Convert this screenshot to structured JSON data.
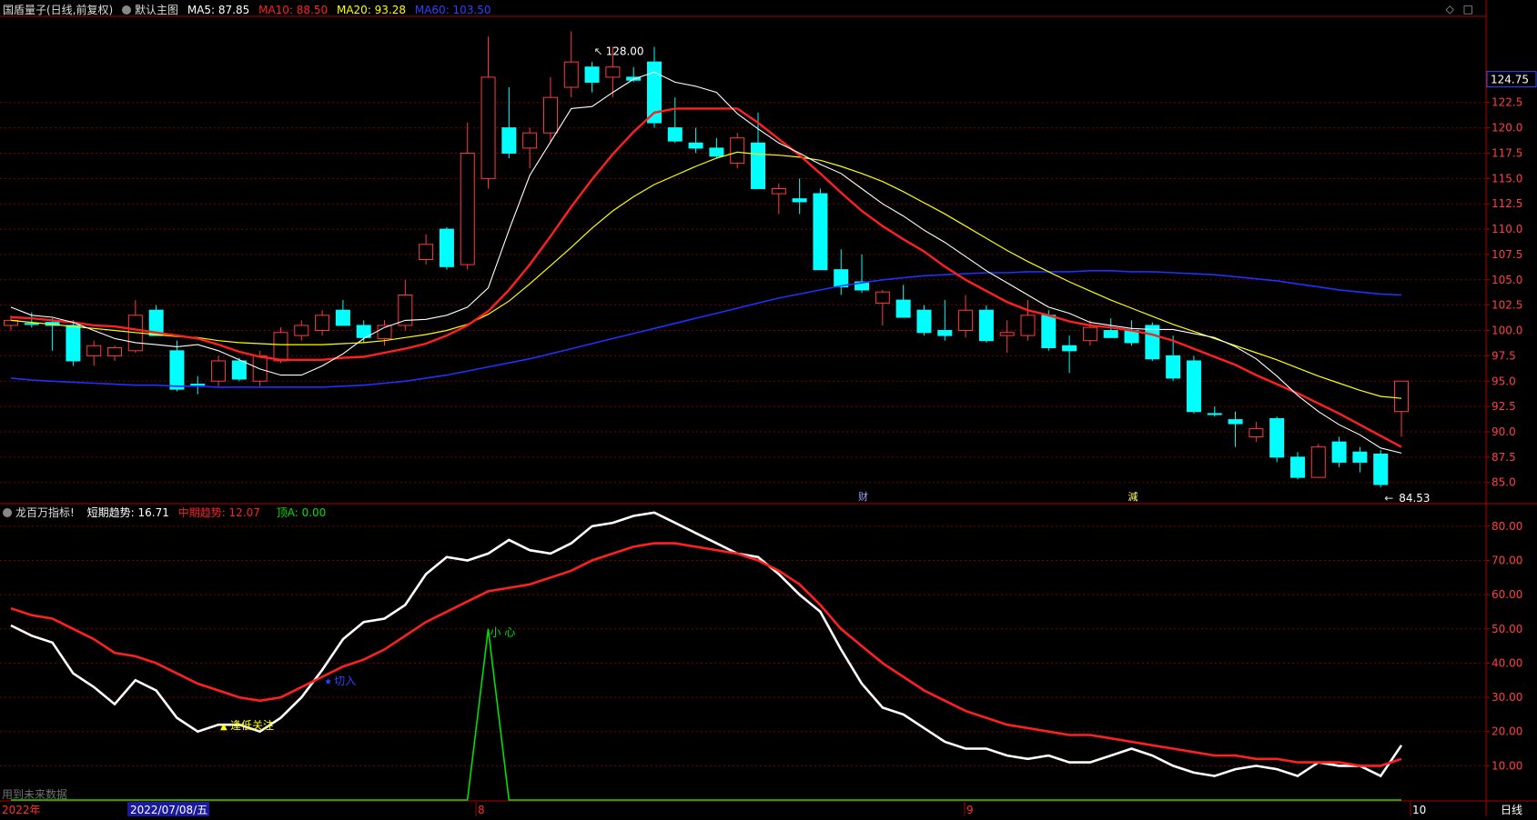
{
  "top_panel": {
    "header": {
      "stock": "国盾量子(日线,前复权)",
      "main_label": "默认主图",
      "ma5": "MA5: 87.85",
      "ma10": "MA10: 88.50",
      "ma20": "MA20: 93.28",
      "ma60": "MA60: 103.50"
    },
    "current_price": "124.75",
    "high_label": "128.00",
    "low_label": "84.53",
    "marker_cai": "财",
    "marker_jian": "減"
  },
  "bottom_panel": {
    "header": {
      "title": "龙百万指标!",
      "short": "短期趋势: 16.71",
      "mid": "中期趋势: 12.07",
      "top": "顶A: 0.00"
    },
    "ann_low": "逢低关注",
    "ann_buy": "切入",
    "ann_careful": "小 心",
    "status_text": "用到未来数据"
  },
  "bottom_axis": {
    "year": "2022年",
    "date": "2022/07/08/五",
    "m8": "8",
    "m9": "9",
    "m10": "10",
    "period": "日线"
  },
  "colors": {
    "up": "#ff3b3b",
    "down": "#00ffff",
    "ma5": "#ffffff",
    "ma10": "#ff2020",
    "ma20": "#ffff00",
    "ma60": "#2030ff",
    "grid": "#7a0000"
  },
  "chart_data": [
    {
      "type": "candlestick",
      "title": "国盾量子(日线,前复权)",
      "ylim": [
        83,
        131
      ],
      "y_ticks": [
        85.0,
        87.5,
        90.0,
        92.5,
        95.0,
        97.5,
        100.0,
        102.5,
        105.0,
        107.5,
        110.0,
        112.5,
        115.0,
        117.5,
        120.0,
        122.5
      ],
      "candles": [
        [
          100.5,
          101.5,
          100.0,
          101.0
        ],
        [
          100.7,
          101.8,
          100.3,
          100.6
        ],
        [
          100.8,
          101.2,
          98.0,
          100.5
        ],
        [
          100.5,
          101.0,
          96.5,
          97.0
        ],
        [
          97.5,
          99.0,
          96.5,
          98.5
        ],
        [
          97.5,
          98.5,
          97.0,
          98.3
        ],
        [
          98.0,
          103.0,
          97.8,
          101.5
        ],
        [
          102.0,
          102.5,
          99.5,
          99.5
        ],
        [
          98.0,
          99.0,
          94.0,
          94.2
        ],
        [
          94.7,
          95.5,
          93.7,
          94.6
        ],
        [
          95.0,
          97.5,
          94.5,
          97.0
        ],
        [
          97.0,
          97.3,
          95.0,
          95.2
        ],
        [
          95.0,
          98.0,
          94.5,
          97.5
        ],
        [
          97.0,
          100.3,
          96.8,
          99.8
        ],
        [
          99.5,
          101.0,
          99.0,
          100.5
        ],
        [
          100.0,
          102.0,
          99.5,
          101.5
        ],
        [
          102.0,
          103.0,
          100.5,
          100.5
        ],
        [
          100.5,
          101.0,
          98.8,
          99.3
        ],
        [
          99.2,
          101.0,
          98.5,
          100.5
        ],
        [
          100.5,
          105.0,
          100.0,
          103.5
        ],
        [
          107.0,
          109.5,
          106.5,
          108.5
        ],
        [
          110.0,
          110.2,
          106.0,
          106.3
        ],
        [
          106.5,
          120.5,
          106.0,
          117.5
        ],
        [
          115.0,
          129.0,
          114.0,
          125.0
        ],
        [
          120.0,
          124.0,
          117.0,
          117.5
        ],
        [
          118.0,
          120.0,
          116.0,
          119.5
        ],
        [
          119.5,
          125.0,
          118.5,
          123.0
        ],
        [
          124.0,
          129.5,
          123.0,
          126.5
        ],
        [
          126.0,
          126.5,
          123.5,
          124.5
        ],
        [
          125.0,
          128.0,
          123.0,
          126.0
        ],
        [
          125.0,
          126.0,
          124.5,
          124.7
        ],
        [
          126.5,
          128.0,
          120.0,
          120.5
        ],
        [
          120.0,
          123.0,
          118.5,
          118.7
        ],
        [
          118.5,
          120.0,
          117.5,
          118.0
        ],
        [
          118.0,
          119.0,
          117.0,
          117.2
        ],
        [
          116.5,
          119.5,
          116.0,
          119.0
        ],
        [
          118.5,
          121.5,
          114.0,
          114.0
        ],
        [
          113.5,
          114.5,
          111.5,
          114.0
        ],
        [
          113.0,
          115.0,
          111.5,
          112.7
        ],
        [
          113.5,
          114.0,
          106.0,
          106.0
        ],
        [
          106.0,
          108.0,
          103.5,
          104.3
        ],
        [
          104.8,
          107.5,
          103.7,
          104.0
        ],
        [
          102.7,
          104.0,
          100.5,
          103.8
        ],
        [
          103.0,
          104.5,
          101.5,
          101.3
        ],
        [
          102.0,
          102.5,
          99.5,
          99.8
        ],
        [
          100.0,
          103.0,
          99.0,
          99.5
        ],
        [
          100.0,
          103.5,
          99.3,
          102.0
        ],
        [
          102.0,
          102.5,
          98.8,
          99.0
        ],
        [
          99.5,
          101.0,
          97.8,
          99.8
        ],
        [
          99.5,
          103.0,
          99.0,
          101.5
        ],
        [
          101.5,
          102.0,
          98.0,
          98.3
        ],
        [
          98.5,
          99.5,
          95.8,
          98.0
        ],
        [
          99.0,
          101.0,
          98.5,
          100.3
        ],
        [
          100.0,
          101.2,
          99.5,
          99.3
        ],
        [
          100.0,
          101.0,
          98.5,
          98.8
        ],
        [
          100.5,
          100.8,
          97.0,
          97.2
        ],
        [
          97.5,
          99.5,
          95.0,
          95.3
        ],
        [
          97.0,
          97.5,
          91.8,
          92.0
        ],
        [
          91.8,
          92.5,
          91.5,
          91.7
        ],
        [
          91.2,
          92.0,
          88.5,
          90.8
        ],
        [
          89.5,
          91.0,
          89.0,
          90.3
        ],
        [
          91.3,
          91.5,
          87.0,
          87.5
        ],
        [
          87.5,
          88.0,
          85.3,
          85.5
        ],
        [
          85.5,
          88.8,
          85.5,
          88.5
        ],
        [
          89.0,
          89.5,
          86.5,
          87.0
        ],
        [
          88.0,
          88.5,
          86.0,
          87.0
        ],
        [
          87.8,
          88.2,
          84.5,
          84.8
        ],
        [
          92.0,
          95.0,
          89.5,
          95.0
        ]
      ],
      "ma_series": {
        "ma5": [
          102.3,
          101.5,
          101.3,
          100.8,
          100.0,
          99.2,
          98.8,
          98.6,
          98.4,
          98.6,
          98.0,
          97.1,
          96.2,
          95.6,
          95.6,
          96.5,
          97.7,
          99.2,
          100.3,
          101.0,
          101.1,
          101.5,
          102.3,
          104.2,
          109.9,
          115.3,
          118.6,
          121.9,
          122.1,
          123.5,
          124.8,
          125.5,
          124.5,
          124.1,
          123.5,
          121.4,
          119.9,
          118.5,
          117.5,
          116.4,
          115.5,
          114.0,
          112.5,
          111.3,
          109.9,
          108.7,
          107.3,
          105.9,
          104.7,
          103.5,
          102.3,
          101.7,
          100.8,
          100.5,
          100.2,
          100.1,
          100.1,
          99.7,
          99.3,
          98.4,
          97.2,
          95.5,
          93.6,
          92.0,
          90.7,
          89.7,
          88.4,
          87.9
        ],
        "ma10": [
          101.3,
          101.2,
          101.0,
          100.8,
          100.5,
          100.4,
          100.1,
          99.8,
          99.5,
          99.2,
          98.6,
          97.9,
          97.4,
          97.1,
          97.1,
          97.1,
          97.3,
          97.4,
          97.8,
          98.2,
          98.7,
          99.5,
          100.5,
          101.9,
          104.0,
          106.5,
          109.3,
          112.2,
          114.9,
          117.4,
          119.6,
          121.5,
          121.9,
          121.9,
          121.9,
          121.9,
          120.5,
          118.9,
          117.3,
          115.5,
          113.6,
          111.8,
          110.3,
          109.0,
          107.8,
          106.3,
          105.0,
          103.9,
          102.8,
          102.0,
          101.5,
          100.9,
          100.5,
          100.3,
          100.0,
          99.6,
          99.0,
          98.2,
          97.4,
          96.6,
          95.6,
          94.7,
          93.8,
          92.8,
          91.8,
          90.7,
          89.6,
          88.5
        ],
        "ma20": [
          101.0,
          100.8,
          100.6,
          100.4,
          100.2,
          100.0,
          99.8,
          99.6,
          99.4,
          99.3,
          99.0,
          98.8,
          98.7,
          98.6,
          98.6,
          98.6,
          98.7,
          98.8,
          99.0,
          99.3,
          99.6,
          100.0,
          100.6,
          101.6,
          102.9,
          104.6,
          106.4,
          108.2,
          110.1,
          111.8,
          113.2,
          114.4,
          115.3,
          116.2,
          117.0,
          117.6,
          117.4,
          117.3,
          117.1,
          116.8,
          116.2,
          115.5,
          114.7,
          113.7,
          112.6,
          111.5,
          110.3,
          109.1,
          107.9,
          106.8,
          105.8,
          104.8,
          103.9,
          103.0,
          102.2,
          101.4,
          100.6,
          99.9,
          99.2,
          98.5,
          97.8,
          97.1,
          96.3,
          95.5,
          94.8,
          94.1,
          93.5,
          93.3
        ],
        "ma60": [
          95.3,
          95.1,
          95.0,
          94.9,
          94.8,
          94.7,
          94.6,
          94.6,
          94.5,
          94.5,
          94.4,
          94.4,
          94.4,
          94.4,
          94.4,
          94.4,
          94.5,
          94.6,
          94.8,
          95.0,
          95.3,
          95.6,
          96.0,
          96.4,
          96.8,
          97.2,
          97.7,
          98.2,
          98.7,
          99.2,
          99.7,
          100.2,
          100.7,
          101.2,
          101.7,
          102.2,
          102.7,
          103.2,
          103.6,
          104.0,
          104.4,
          104.7,
          105.0,
          105.2,
          105.4,
          105.5,
          105.6,
          105.7,
          105.7,
          105.8,
          105.8,
          105.8,
          105.9,
          105.9,
          105.8,
          105.8,
          105.7,
          105.6,
          105.5,
          105.3,
          105.1,
          104.9,
          104.6,
          104.3,
          104.0,
          103.8,
          103.6,
          103.5
        ]
      }
    },
    {
      "type": "line",
      "title": "龙百万指标!",
      "ylim": [
        0,
        85
      ],
      "y_ticks": [
        10.0,
        20.0,
        30.0,
        40.0,
        50.0,
        60.0,
        70.0,
        80.0
      ],
      "series": [
        {
          "name": "短期趋势",
          "color": "#ffffff",
          "values": [
            51,
            48,
            46,
            37,
            33,
            28,
            35,
            32,
            24,
            20,
            22,
            22,
            20,
            24,
            30,
            38,
            47,
            52,
            53,
            57,
            66,
            71,
            70,
            72,
            76,
            73,
            72,
            75,
            80,
            81,
            83,
            84,
            81,
            78,
            75,
            72,
            71,
            66,
            60,
            55,
            44,
            34,
            27,
            25,
            21,
            17,
            15,
            15,
            13,
            12,
            13,
            11,
            11,
            13,
            15,
            13,
            10,
            8,
            7,
            9,
            10,
            9,
            7,
            11,
            10,
            10,
            7,
            16
          ]
        },
        {
          "name": "中期趋势",
          "color": "#ff2020",
          "values": [
            56,
            54,
            53,
            50,
            47,
            43,
            42,
            40,
            37,
            34,
            32,
            30,
            29,
            30,
            33,
            36,
            39,
            41,
            44,
            48,
            52,
            55,
            58,
            61,
            62,
            63,
            65,
            67,
            70,
            72,
            74,
            75,
            75,
            74,
            73,
            72,
            70,
            67,
            63,
            57,
            50,
            45,
            40,
            36,
            32,
            29,
            26,
            24,
            22,
            21,
            20,
            19,
            19,
            18,
            17,
            16,
            15,
            14,
            13,
            13,
            12,
            12,
            11,
            11,
            11,
            10,
            10,
            12
          ]
        },
        {
          "name": "顶A",
          "color": "#00e000",
          "values": [
            0,
            0,
            0,
            0,
            0,
            0,
            0,
            0,
            0,
            0,
            0,
            0,
            0,
            0,
            0,
            0,
            0,
            0,
            0,
            0,
            0,
            0,
            0,
            50,
            0,
            0,
            0,
            0,
            0,
            0,
            0,
            0,
            0,
            0,
            0,
            0,
            0,
            0,
            0,
            0,
            0,
            0,
            0,
            0,
            0,
            0,
            0,
            0,
            0,
            0,
            0,
            0,
            0,
            0,
            0,
            0,
            0,
            0,
            0,
            0,
            0,
            0,
            0,
            0,
            0,
            0,
            0,
            0
          ]
        }
      ]
    }
  ]
}
